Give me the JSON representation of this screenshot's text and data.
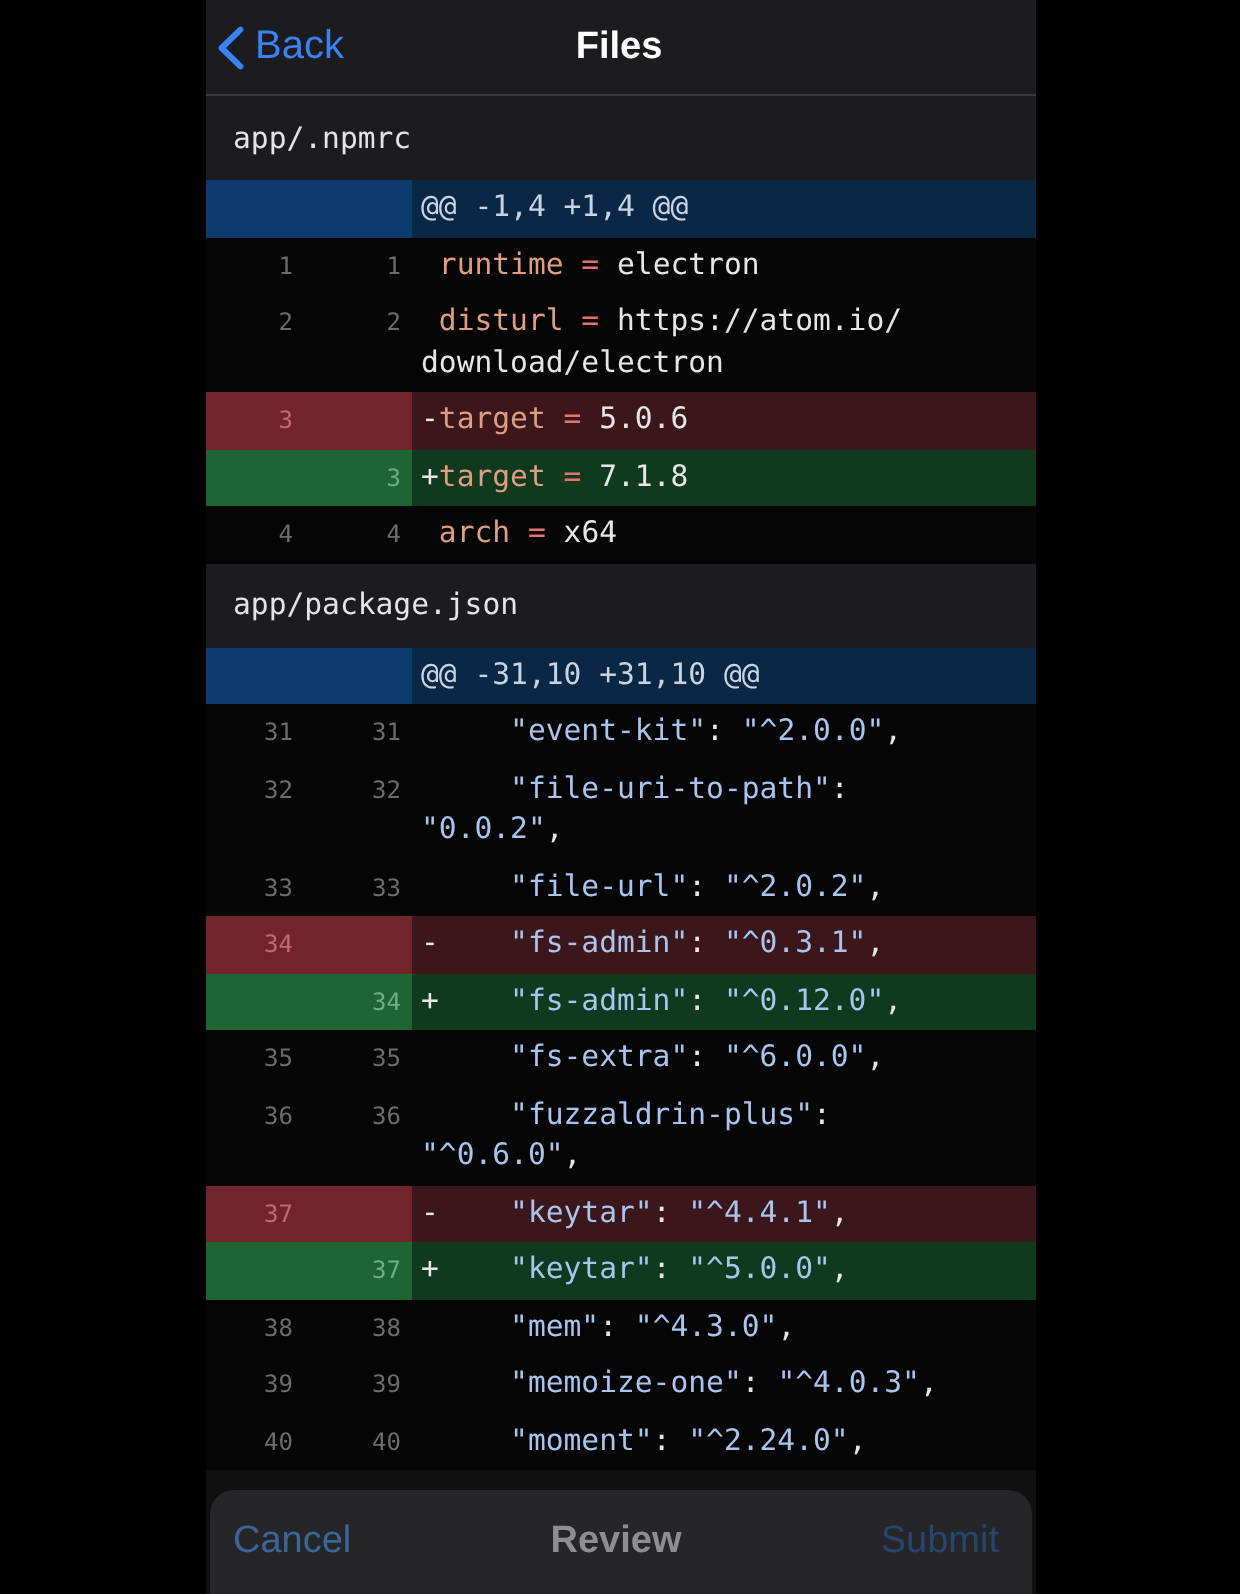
{
  "nav": {
    "back": "Back",
    "title": "Files"
  },
  "files": [
    {
      "path": "app/.npmrc",
      "hunks": [
        {
          "header": "@@ -1,4 +1,4 @@",
          "lines": [
            {
              "kind": "context",
              "old": "1",
              "new": "1",
              "tokens": [
                {
                  "text": "runtime",
                  "kind": "name"
                },
                {
                  "text": " = ",
                  "kind": "op"
                },
                {
                  "text": "electron",
                  "kind": "plain"
                }
              ]
            },
            {
              "kind": "context",
              "old": "2",
              "new": "2",
              "tokens": [
                {
                  "text": "disturl",
                  "kind": "name"
                },
                {
                  "text": " = ",
                  "kind": "op"
                },
                {
                  "text": "https://atom.io/",
                  "kind": "plain"
                },
                {
                  "text": "download/electron",
                  "kind": "plain"
                }
              ]
            },
            {
              "kind": "deleted",
              "old": "3",
              "prefix": "-",
              "tokens": [
                {
                  "text": "target",
                  "kind": "name"
                },
                {
                  "text": " = ",
                  "kind": "op"
                },
                {
                  "text": "5.0.6",
                  "kind": "plain"
                }
              ]
            },
            {
              "kind": "added",
              "new": "3",
              "prefix": "+",
              "tokens": [
                {
                  "text": "target",
                  "kind": "name"
                },
                {
                  "text": " = ",
                  "kind": "op"
                },
                {
                  "text": "7.1.8",
                  "kind": "plain"
                }
              ]
            },
            {
              "kind": "context",
              "old": "4",
              "new": "4",
              "tokens": [
                {
                  "text": "arch",
                  "kind": "name"
                },
                {
                  "text": " = ",
                  "kind": "op"
                },
                {
                  "text": "x64",
                  "kind": "plain"
                }
              ]
            }
          ]
        }
      ]
    },
    {
      "path": "app/package.json",
      "hunks": [
        {
          "header": "@@ -31,10 +31,10 @@",
          "lines": [
            {
              "kind": "context",
              "old": "31",
              "new": "31",
              "tokens": [
                {
                  "text": "    \"event-kit\"",
                  "kind": "string"
                },
                {
                  "text": ": ",
                  "kind": "plain"
                },
                {
                  "text": "\"^2.0.0\"",
                  "kind": "string"
                },
                {
                  "text": ",",
                  "kind": "plain"
                }
              ]
            },
            {
              "kind": "context",
              "old": "32",
              "new": "32",
              "tokens": [
                {
                  "text": "    \"file-uri-to-path\"",
                  "kind": "string"
                },
                {
                  "text": ": ",
                  "kind": "plain"
                },
                {
                  "text": "\"0.0.2\"",
                  "kind": "string"
                },
                {
                  "text": ",",
                  "kind": "plain"
                }
              ]
            },
            {
              "kind": "context",
              "old": "33",
              "new": "33",
              "tokens": [
                {
                  "text": "    \"file-url\"",
                  "kind": "string"
                },
                {
                  "text": ": ",
                  "kind": "plain"
                },
                {
                  "text": "\"^2.0.2\"",
                  "kind": "string"
                },
                {
                  "text": ",",
                  "kind": "plain"
                }
              ]
            },
            {
              "kind": "deleted",
              "old": "34",
              "prefix": "-",
              "tokens": [
                {
                  "text": "    \"fs-admin\"",
                  "kind": "string"
                },
                {
                  "text": ": ",
                  "kind": "plain"
                },
                {
                  "text": "\"^0.3.1\"",
                  "kind": "string"
                },
                {
                  "text": ",",
                  "kind": "plain"
                }
              ]
            },
            {
              "kind": "added",
              "new": "34",
              "prefix": "+",
              "tokens": [
                {
                  "text": "    \"fs-admin\"",
                  "kind": "string"
                },
                {
                  "text": ": ",
                  "kind": "plain"
                },
                {
                  "text": "\"^0.12.0\"",
                  "kind": "string"
                },
                {
                  "text": ",",
                  "kind": "plain"
                }
              ]
            },
            {
              "kind": "context",
              "old": "35",
              "new": "35",
              "tokens": [
                {
                  "text": "    \"fs-extra\"",
                  "kind": "string"
                },
                {
                  "text": ": ",
                  "kind": "plain"
                },
                {
                  "text": "\"^6.0.0\"",
                  "kind": "string"
                },
                {
                  "text": ",",
                  "kind": "plain"
                }
              ]
            },
            {
              "kind": "context",
              "old": "36",
              "new": "36",
              "tokens": [
                {
                  "text": "    \"fuzzaldrin-plus\"",
                  "kind": "string"
                },
                {
                  "text": ": ",
                  "kind": "plain"
                },
                {
                  "text": "\"^0.6.0\"",
                  "kind": "string"
                },
                {
                  "text": ",",
                  "kind": "plain"
                }
              ]
            },
            {
              "kind": "deleted",
              "old": "37",
              "prefix": "-",
              "tokens": [
                {
                  "text": "    \"keytar\"",
                  "kind": "string"
                },
                {
                  "text": ": ",
                  "kind": "plain"
                },
                {
                  "text": "\"^4.4.1\"",
                  "kind": "string"
                },
                {
                  "text": ",",
                  "kind": "plain"
                }
              ]
            },
            {
              "kind": "added",
              "new": "37",
              "prefix": "+",
              "tokens": [
                {
                  "text": "    \"keytar\"",
                  "kind": "string"
                },
                {
                  "text": ": ",
                  "kind": "plain"
                },
                {
                  "text": "\"^5.0.0\"",
                  "kind": "string"
                },
                {
                  "text": ",",
                  "kind": "plain"
                }
              ]
            },
            {
              "kind": "context",
              "old": "38",
              "new": "38",
              "tokens": [
                {
                  "text": "    \"mem\"",
                  "kind": "string"
                },
                {
                  "text": ": ",
                  "kind": "plain"
                },
                {
                  "text": "\"^4.3.0\"",
                  "kind": "string"
                },
                {
                  "text": ",",
                  "kind": "plain"
                }
              ]
            },
            {
              "kind": "context",
              "old": "39",
              "new": "39",
              "tokens": [
                {
                  "text": "    \"memoize-one\"",
                  "kind": "string"
                },
                {
                  "text": ": ",
                  "kind": "plain"
                },
                {
                  "text": "\"^4.0.3\"",
                  "kind": "string"
                },
                {
                  "text": ",",
                  "kind": "plain"
                }
              ]
            },
            {
              "kind": "context",
              "old": "40",
              "new": "40",
              "tokens": [
                {
                  "text": "    \"moment\"",
                  "kind": "string"
                },
                {
                  "text": ": ",
                  "kind": "plain"
                },
                {
                  "text": "\"^2.24.0\"",
                  "kind": "string"
                },
                {
                  "text": ",",
                  "kind": "plain"
                }
              ]
            }
          ]
        }
      ]
    }
  ],
  "toolbar": {
    "cancel": {
      "label": "Cancel",
      "disabled": false
    },
    "title": "Review",
    "submit": {
      "label": "Submit",
      "disabled": true
    }
  }
}
